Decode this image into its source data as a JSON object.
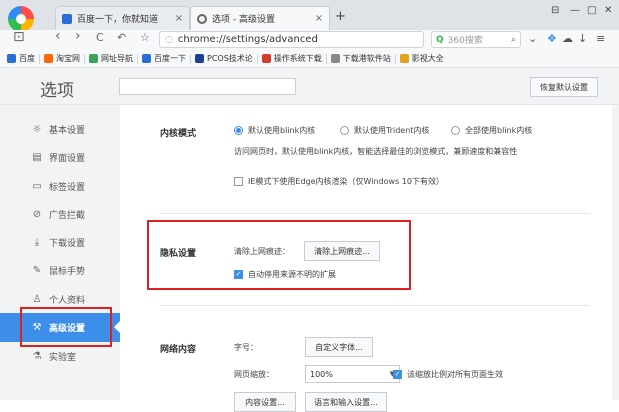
{
  "browser": {
    "tabs": [
      {
        "title": "百度一下，你就知道",
        "close": "×",
        "favicon_color": "#2c6cd6"
      },
      {
        "title": "选项 - 高级设置",
        "close": "×",
        "favicon_color": "#666666"
      }
    ],
    "new_tab": "+",
    "window_controls": {
      "pin": "⊟",
      "minimize": "—",
      "maximize": "□",
      "close": "✕"
    },
    "url": "chrome://settings/advanced",
    "search_placeholder": "360搜索",
    "nav": {
      "back": "‹",
      "forward": "›",
      "reload": "C",
      "undo": "↶",
      "star": "☆",
      "url_icon": "◌",
      "search_icon": "Q"
    },
    "toolbar_icons": {
      "dropdown": "⌄",
      "apps": "❖",
      "cloud": "☁",
      "download": "↓",
      "menu": "≡"
    }
  },
  "bookmarks": [
    {
      "label": "百度",
      "color": "#2c6cd6"
    },
    {
      "label": "淘宝网",
      "color": "#ff6a00"
    },
    {
      "label": "网址导航",
      "color": "#3da35a"
    },
    {
      "label": "百度一下",
      "color": "#2c6cd6"
    },
    {
      "label": "PCOS技术论",
      "color": "#1c3f94"
    },
    {
      "label": "操作系统下载",
      "color": "#d33b2c"
    },
    {
      "label": "下载港软件站",
      "color": "#888888"
    },
    {
      "label": "影视大全",
      "color": "#e3a21a"
    }
  ],
  "settings": {
    "title": "选项",
    "restore_button": "恢复默认设置",
    "sidebar": [
      {
        "label": "基本设置",
        "icon": "☼",
        "active": false
      },
      {
        "label": "界面设置",
        "icon": "▤",
        "active": false
      },
      {
        "label": "标签设置",
        "icon": "▭",
        "active": false
      },
      {
        "label": "广告拦截",
        "icon": "⊘",
        "active": false
      },
      {
        "label": "下载设置",
        "icon": "⤓",
        "active": false
      },
      {
        "label": "鼠标手势",
        "icon": "✎",
        "active": false
      },
      {
        "label": "个人资料",
        "icon": "♙",
        "active": false
      },
      {
        "label": "高级设置",
        "icon": "⚒",
        "active": true
      },
      {
        "label": "实验室",
        "icon": "⚗",
        "active": false
      }
    ],
    "kernel": {
      "title": "内核模式",
      "options": [
        "默认使用blink内核",
        "默认使用Trident内核",
        "全部使用blink内核"
      ],
      "selected_index": 0,
      "description": "访问网页时，默认使用blink内核，智能选择最佳的浏览模式，兼顾速度和兼容性",
      "ie_edge_label": "IE模式下使用Edge内核渲染（仅Windows 10下有效）",
      "ie_edge_checked": false
    },
    "privacy": {
      "title": "隐私设置",
      "clear_label": "清除上网痕迹：",
      "clear_button": "清除上网痕迹...",
      "auto_disable_label": "自动停用来源不明的扩展",
      "auto_disable_checked": true
    },
    "web_content": {
      "title": "网络内容",
      "font_label": "字号：",
      "font_button": "自定义字体...",
      "zoom_label": "网页缩放：",
      "zoom_value": "100%",
      "zoom_checkbox_label": "该缩放比例对所有页面生效",
      "zoom_checked": true,
      "content_settings_button": "内容设置...",
      "language_button": "语言和输入设置..."
    }
  },
  "colors": {
    "accent": "#3d8ee8",
    "highlight": "#e02020"
  }
}
